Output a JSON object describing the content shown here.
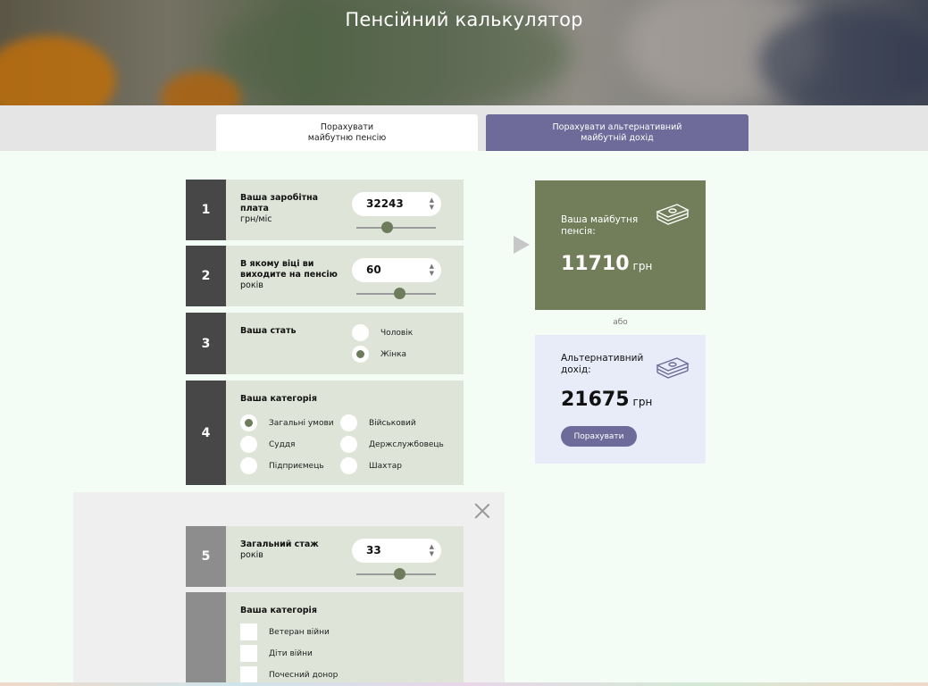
{
  "page": {
    "title": "Пенсійний калькулятор"
  },
  "tabs": [
    {
      "label": "Порахувати\nмайбутню пенсію"
    },
    {
      "label": "Порахувати альтернативний\nмайбутній дохід"
    }
  ],
  "steps": {
    "s1": {
      "num": "1",
      "label": "Ваша заробітна плата",
      "unit": "грн/міс",
      "value": "32243",
      "slider_fraction": 0.39
    },
    "s2": {
      "num": "2",
      "label": "В якому віці ви виходите на пенсію",
      "unit": "років",
      "value": "60",
      "slider_fraction": 0.55
    },
    "s3": {
      "num": "3",
      "label": "Ваша стать",
      "options": [
        "Чоловік",
        "Жінка"
      ],
      "selected": "Жінка"
    },
    "s4": {
      "num": "4",
      "label": "Ваша категорія",
      "options": [
        "Загальні умови",
        "Військовий",
        "Суддя",
        "Держслужбовець",
        "Підприємець",
        "Шахтар"
      ],
      "selected": "Загальні умови"
    },
    "s5": {
      "num": "5",
      "label": "Загальний стаж",
      "unit": "років",
      "value": "33",
      "slider_fraction": 0.54
    },
    "s6": {
      "label": "Ваша категорія",
      "options": [
        "Ветеран війни",
        "Діти війни",
        "Почесний донор"
      ]
    }
  },
  "result": {
    "future_label": "Ваша майбутня пенсія:",
    "future_value": "11710",
    "currency": "грн",
    "or": "або",
    "alt_label": "Альтернативний дохід:",
    "alt_value": "21675",
    "calc_button": "Порахувати"
  },
  "icons": {
    "money": "money-stack-icon",
    "close": "close-icon",
    "arrow": "arrow-right-icon"
  },
  "colors": {
    "accent_green": "#727d59",
    "accent_purple": "#6e6a99",
    "step_bg": "#dfe4d8",
    "alt_bg": "#e8ebf8"
  }
}
